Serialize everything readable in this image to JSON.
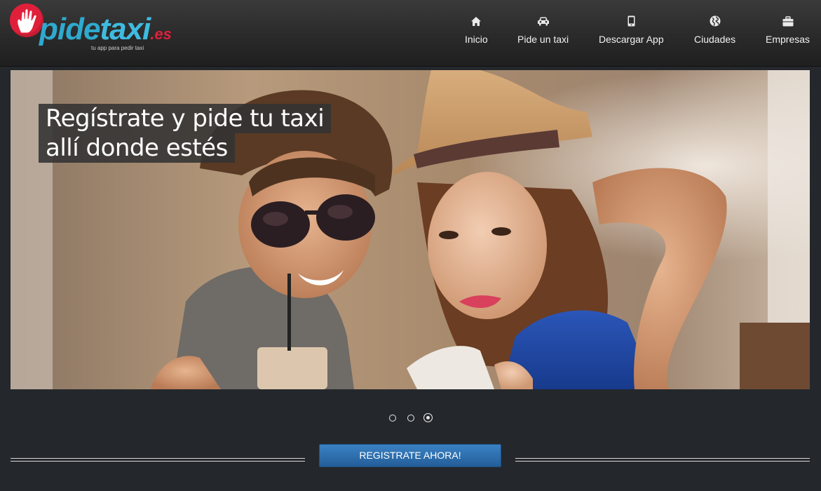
{
  "brand": {
    "name_part1": "pide",
    "name_part2": "taxi",
    "name_part3": ".es",
    "tagline": "tu app para pedir taxi",
    "logo_icon": "hand-icon",
    "colors": {
      "blue": "#3fbbe0",
      "red": "#e0203a"
    }
  },
  "nav": {
    "items": [
      {
        "label": "Inicio",
        "icon": "home-icon"
      },
      {
        "label": "Pide un taxi",
        "icon": "car-icon"
      },
      {
        "label": "Descargar App",
        "icon": "phone-icon"
      },
      {
        "label": "Ciudades",
        "icon": "globe-icon"
      },
      {
        "label": "Empresas",
        "icon": "briefcase-icon"
      }
    ]
  },
  "slider": {
    "caption_line1": "Regístrate y pide tu taxi",
    "caption_line2": "allí donde estés",
    "slide_count": 3,
    "active_slide": 3
  },
  "cta": {
    "label": "REGISTRATE AHORA!",
    "color": "#2e6fb0"
  }
}
